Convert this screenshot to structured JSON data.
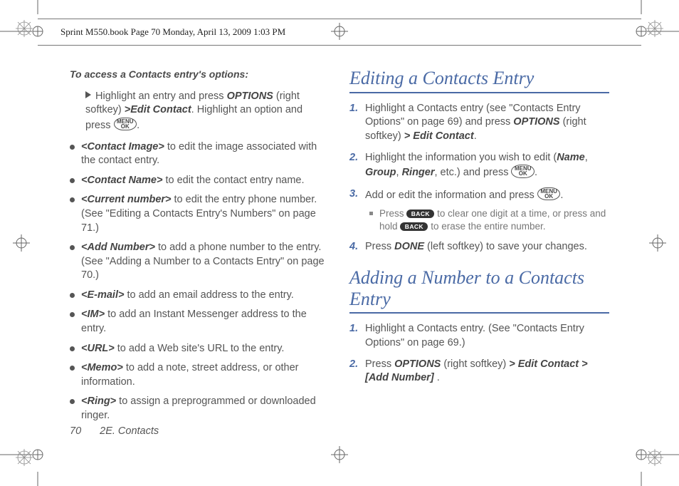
{
  "cropmeta": "Sprint M550.book  Page 70  Monday, April 13, 2009  1:03 PM",
  "left": {
    "intro": "To access a Contacts entry's options:",
    "lead": {
      "pre": "Highlight an entry and press ",
      "key1": "OPTIONS",
      "mid1": " (right softkey) ",
      "gt1": ">",
      "path1": "Edit Contact",
      "mid2": ". Highlight an option and press ",
      "mid3": "."
    },
    "bullets": [
      {
        "tag": "<Contact Image>",
        "rest": " to edit the image associated with the contact entry."
      },
      {
        "tag": "<Contact Name>",
        "rest": " to edit the contact entry name."
      },
      {
        "tag": "<Current number>",
        "rest": " to edit the entry phone number. (See \"Editing a Contacts Entry's Numbers\" on page 71.)"
      },
      {
        "tag": "<Add Number>",
        "rest": " to add a phone number to the entry. (See \"Adding a Number to a Contacts Entry\" on page 70.)"
      },
      {
        "tag": "<E-mail>",
        "rest": " to add an email address to the entry."
      },
      {
        "tag": "<IM>",
        "rest": " to add an Instant Messenger address to the entry."
      },
      {
        "tag": "<URL>",
        "rest": " to add a Web site's URL to the entry."
      },
      {
        "tag": "<Memo>",
        "rest": " to add a note, street address, or other information."
      },
      {
        "tag": "<Ring>",
        "rest": " to assign a preprogrammed or downloaded ringer."
      }
    ]
  },
  "right": {
    "h1": "Editing a Contacts Entry",
    "steps1": {
      "s1a": "Highlight a Contacts entry (see \"Contacts Entry Options\" on page 69) and press ",
      "s1b": "OPTIONS",
      "s1c": " (right softkey) ",
      "s1gt": ">",
      "s1d": " Edit Contact",
      "s1e": ".",
      "s2a": "Highlight the information you wish to edit (",
      "s2b": "Name",
      "s2c": ", ",
      "s2d": "Group",
      "s2e": ", ",
      "s2f": "Ringer",
      "s2g": ", etc.) and press ",
      "s2h": ".",
      "s3a": "Add or edit the information and press ",
      "s3b": ".",
      "s3sub_a": "Press ",
      "s3sub_b": " to clear one digit at a time, or press and hold ",
      "s3sub_c": " to erase the entire number.",
      "s4a": "Press ",
      "s4b": "DONE",
      "s4c": "  (left softkey) to save your changes."
    },
    "h2": "Adding a Number to a Contacts Entry",
    "steps2": {
      "s1": "Highlight a Contacts entry. (See \"Contacts Entry Options\" on page 69.)",
      "s2a": "Press ",
      "s2b": "OPTIONS",
      "s2c": " (right softkey) ",
      "s2gt1": ">",
      "s2d": " Edit Contact ",
      "s2gt2": ">",
      "s2e": " [Add Number]",
      "s2f": " ."
    }
  },
  "keys": {
    "menu_top": "MENU",
    "menu_bot": "OK",
    "back": "BACK"
  },
  "footer": {
    "page": "70",
    "title": "2E. Contacts"
  }
}
